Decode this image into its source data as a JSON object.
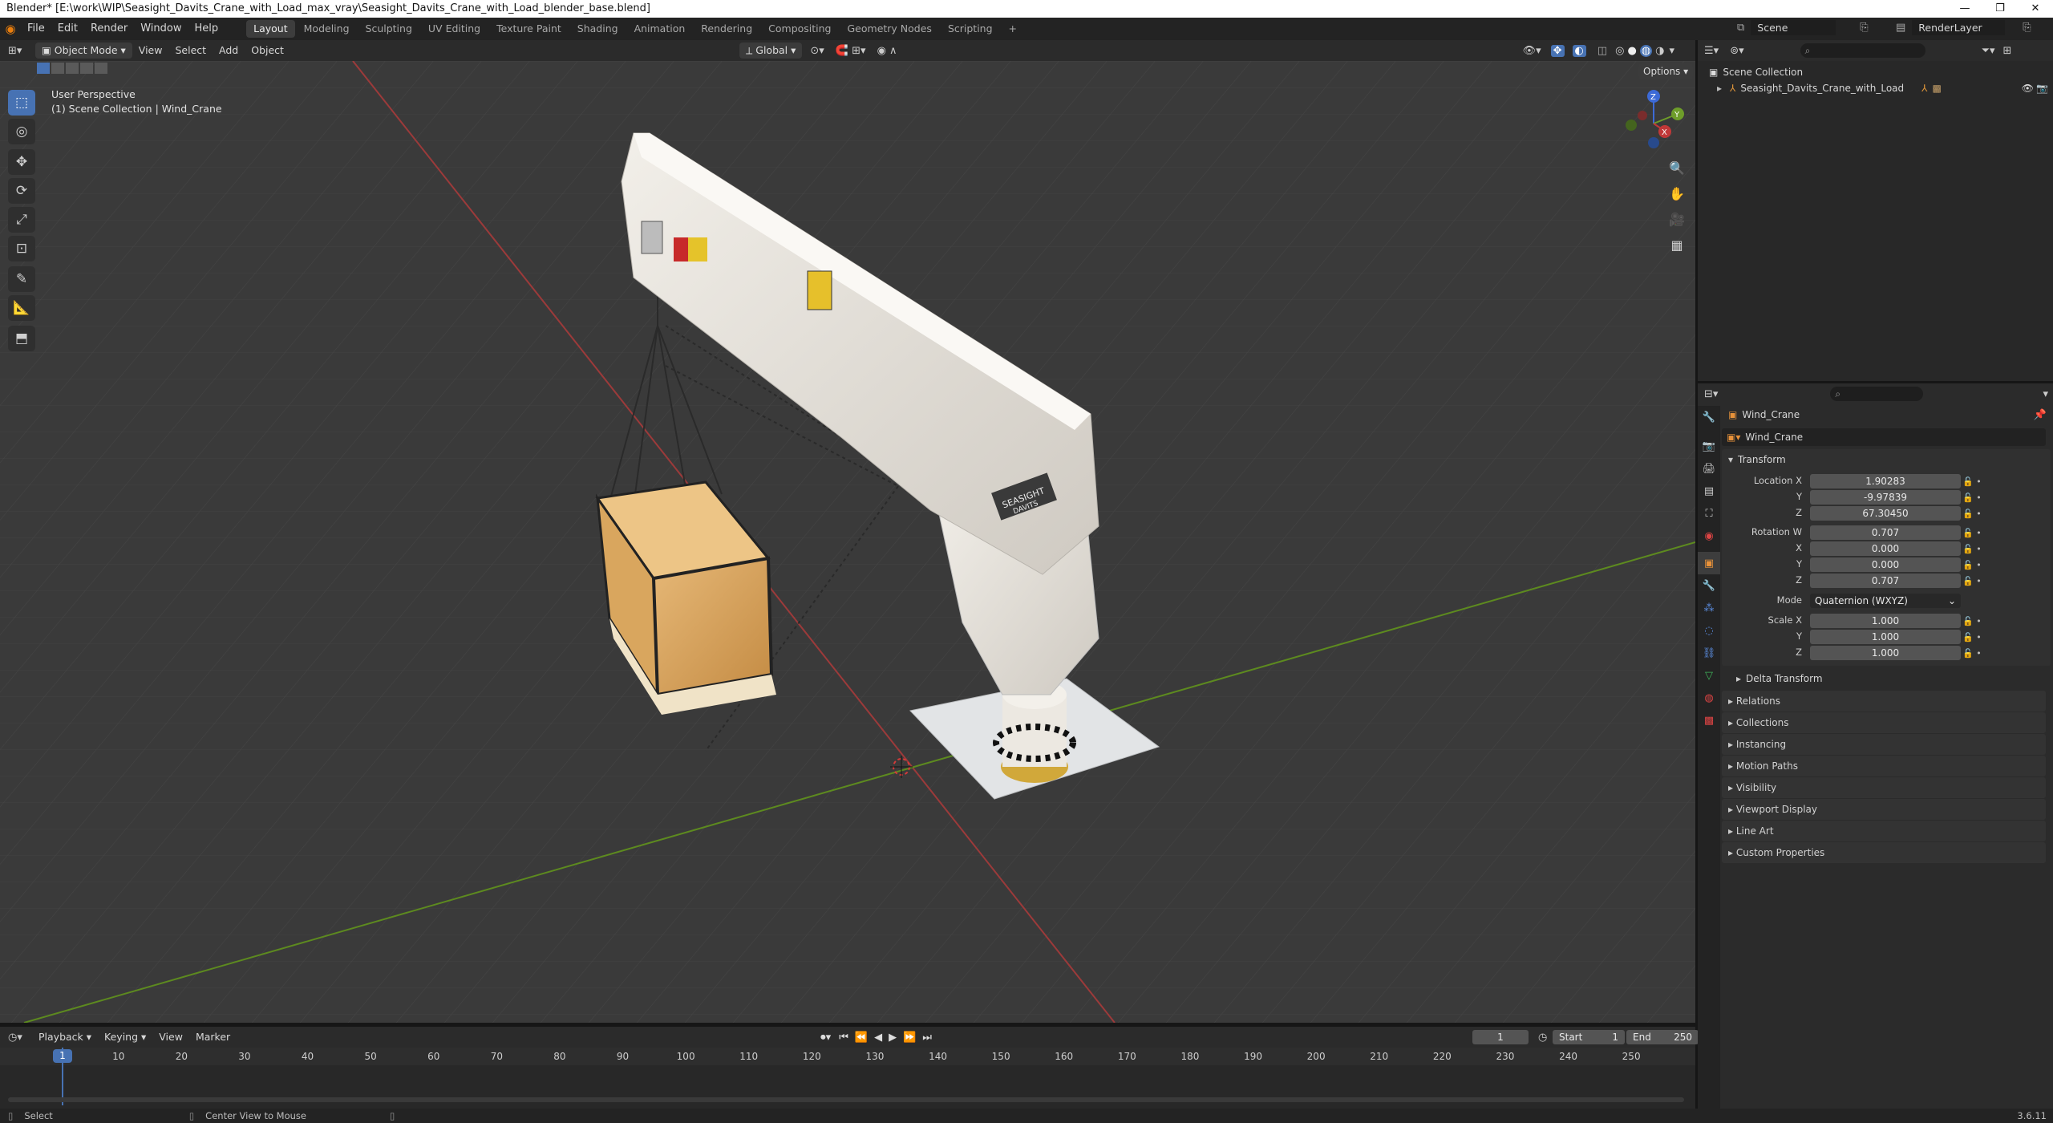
{
  "title_bar": {
    "text": "Blender* [E:\\work\\WIP\\Seasight_Davits_Crane_with_Load_max_vray\\Seasight_Davits_Crane_with_Load_blender_base.blend]",
    "minimize": "—",
    "restore": "❐",
    "close": "✕"
  },
  "menu": [
    "File",
    "Edit",
    "Render",
    "Window",
    "Help"
  ],
  "workspaces": [
    "Layout",
    "Modeling",
    "Sculpting",
    "UV Editing",
    "Texture Paint",
    "Shading",
    "Animation",
    "Rendering",
    "Compositing",
    "Geometry Nodes",
    "Scripting"
  ],
  "active_workspace": "Layout",
  "scene_name": "Scene",
  "view_layer": "RenderLayer",
  "viewport_header": {
    "mode": "Object Mode",
    "menus": [
      "View",
      "Select",
      "Add",
      "Object"
    ],
    "transform_orientation": "Global",
    "options": "Options"
  },
  "viewport": {
    "perspective": "User Perspective",
    "collection_path": "(1) Scene Collection | Wind_Crane",
    "box_label_1": "SEASIGHT",
    "box_label_2": "DAVITS",
    "gizmo_x": "X",
    "gizmo_y": "Y",
    "gizmo_z": "Z"
  },
  "outliner": {
    "root": "Scene Collection",
    "items": [
      {
        "label": "Seasight_Davits_Crane_with_Load"
      }
    ]
  },
  "properties": {
    "object_name": "Wind_Crane",
    "data_name": "Wind_Crane",
    "transform_header": "Transform",
    "location_label": "Location X",
    "location": {
      "x": "1.90283",
      "y": "-9.97839",
      "z": "67.30450"
    },
    "rotation_label": "Rotation W",
    "rotation": {
      "w": "0.707",
      "x": "0.000",
      "y": "0.000",
      "z": "0.707"
    },
    "mode_label": "Mode",
    "mode_value": "Quaternion (WXYZ)",
    "scale_label": "Scale X",
    "scale": {
      "x": "1.000",
      "y": "1.000",
      "z": "1.000"
    },
    "axis_labels": {
      "y": "Y",
      "z": "Z",
      "x": "X"
    },
    "delta_transform": "Delta Transform",
    "panels": [
      "Relations",
      "Collections",
      "Instancing",
      "Motion Paths",
      "Visibility",
      "Viewport Display",
      "Line Art",
      "Custom Properties"
    ]
  },
  "timeline": {
    "menus": [
      "Playback",
      "Keying",
      "View",
      "Marker"
    ],
    "current_frame": "1",
    "start_label": "Start",
    "start": "1",
    "end_label": "End",
    "end": "250",
    "ticks": [
      "1",
      "10",
      "20",
      "30",
      "40",
      "50",
      "60",
      "70",
      "80",
      "90",
      "100",
      "110",
      "120",
      "130",
      "140",
      "150",
      "160",
      "170",
      "180",
      "190",
      "200",
      "210",
      "220",
      "230",
      "240",
      "250"
    ]
  },
  "statusbar": {
    "select": "Select",
    "center": "Center View to Mouse",
    "version": "3.6.11"
  },
  "colors": {
    "accent": "#4772b3",
    "x_axis": "#b53c3c",
    "y_axis": "#6a9a2a",
    "playhead": "#4772b3"
  }
}
